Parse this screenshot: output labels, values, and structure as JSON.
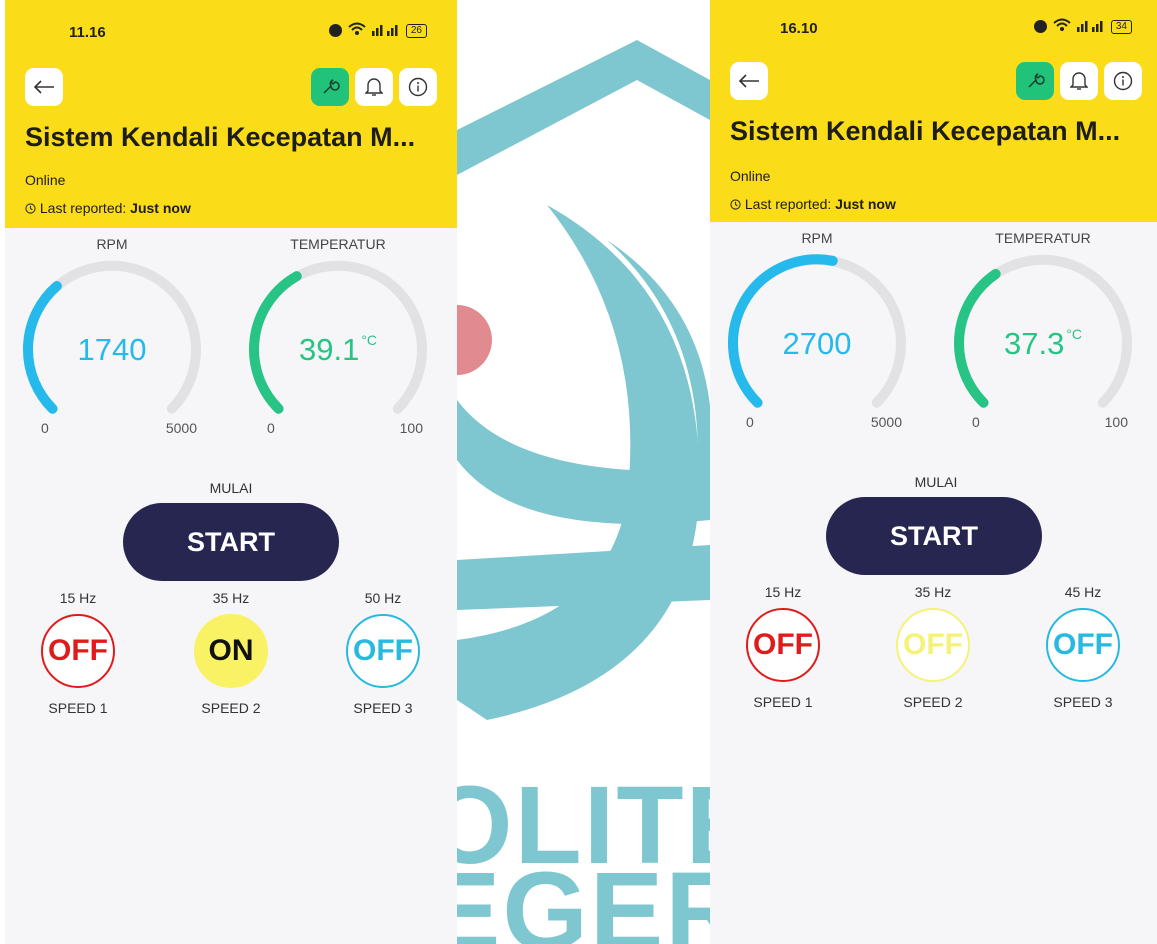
{
  "colors": {
    "header_yellow": "#fbdc18",
    "rpm_blue": "#25b9ec",
    "temp_green": "#27c485",
    "start_navy": "#272650",
    "wrench_green": "#21c37a",
    "off_red": "#e01b1b",
    "off_cyan": "#27b9e0",
    "off_yellow": "#f5f27a",
    "on_yellow": "#f8f264",
    "watermark_teal": "#7ec7d0",
    "watermark_red": "#e18b91"
  },
  "icons": {
    "back": "arrow-left-icon",
    "wrench": "wrench-icon",
    "bell": "bell-icon",
    "info": "info-icon",
    "clock": "clock-icon"
  },
  "left": {
    "status_time": "11.16",
    "battery": "26",
    "title": "Sistem Kendali Kecepatan M...",
    "online": "Online",
    "last_reported_label": "Last reported:",
    "last_reported_value": "Just now",
    "rpm": {
      "label": "RPM",
      "value": 1740,
      "display": "1740",
      "min": "0",
      "max": "5000"
    },
    "temperatur": {
      "label": "TEMPERATUR",
      "value": 39.1,
      "display": "39.1",
      "unit": "°C",
      "min": "0",
      "max": "100"
    },
    "mulai_label": "MULAI",
    "start_label": "START",
    "speeds": [
      {
        "hz": "15 Hz",
        "state": "OFF",
        "name": "SPEED 1",
        "color": "#e01b1b",
        "fill": ""
      },
      {
        "hz": "35 Hz",
        "state": "ON",
        "name": "SPEED 2",
        "color": "#f8f264",
        "fill": "#f8f264"
      },
      {
        "hz": "50 Hz",
        "state": "OFF",
        "name": "SPEED 3",
        "color": "#27b9e0",
        "fill": ""
      }
    ]
  },
  "right": {
    "status_time": "16.10",
    "battery": "34",
    "title": "Sistem Kendali Kecepatan M...",
    "online": "Online",
    "last_reported_label": "Last reported:",
    "last_reported_value": "Just now",
    "rpm": {
      "label": "RPM",
      "value": 2700,
      "display": "2700",
      "min": "0",
      "max": "5000"
    },
    "temperatur": {
      "label": "TEMPERATUR",
      "value": 37.3,
      "display": "37.3",
      "unit": "°C",
      "min": "0",
      "max": "100"
    },
    "mulai_label": "MULAI",
    "start_label": "START",
    "speeds": [
      {
        "hz": "15 Hz",
        "state": "OFF",
        "name": "SPEED 1",
        "color": "#e01b1b",
        "fill": ""
      },
      {
        "hz": "35 Hz",
        "state": "OFF",
        "name": "SPEED 2",
        "color": "#f5f27a",
        "fill": ""
      },
      {
        "hz": "45 Hz",
        "state": "OFF",
        "name": "SPEED 3",
        "color": "#27b9e0",
        "fill": ""
      }
    ]
  },
  "watermark": {
    "line1": "OLITEK",
    "line2": "EGERI"
  }
}
